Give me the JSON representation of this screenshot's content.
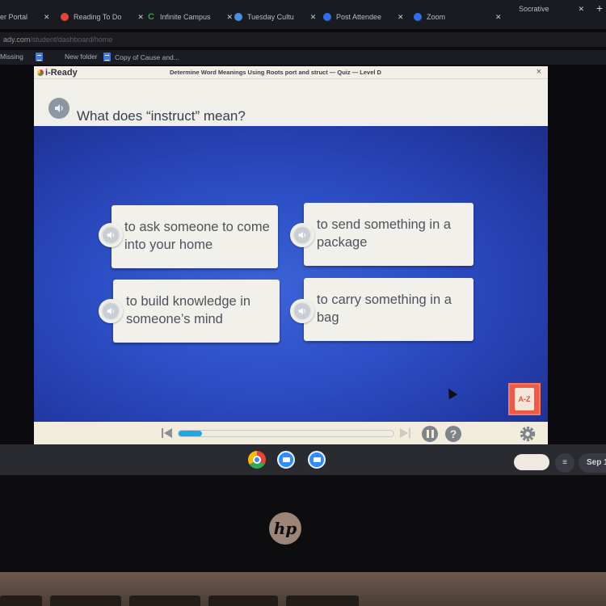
{
  "browser": {
    "tabs": [
      {
        "label": "er Portal",
        "icon": "portal-icon",
        "color": "#555b66"
      },
      {
        "label": "Reading To Do",
        "icon": "flower-icon",
        "color": "#e2463a"
      },
      {
        "label": "Infinite Campus",
        "icon": "campus-icon",
        "color": "#2e9e48"
      },
      {
        "label": "Tuesday Cultu",
        "icon": "globe-icon",
        "color": "#4a8fe0"
      },
      {
        "label": "Post Attendee",
        "icon": "zoom-icon",
        "color": "#2d6ff0"
      },
      {
        "label": "Zoom",
        "icon": "zoom-icon",
        "color": "#2d6ff0"
      },
      {
        "label": "Socrative",
        "icon": "socrative-icon",
        "color": "#666a72"
      }
    ],
    "new_tab_icon": "plus-icon",
    "address": {
      "host": "ady.com",
      "path": "/student/dashboard/home"
    },
    "bookmarks": [
      {
        "label": "Missing",
        "icon": "bookmark-icon"
      },
      {
        "label": "",
        "icon": "docs-icon"
      },
      {
        "label": "New folder",
        "icon": "folder-icon"
      },
      {
        "label": "Copy of Cause and...",
        "icon": "docs-icon"
      }
    ]
  },
  "app": {
    "brand": "i-Ready",
    "lesson_title": "Determine Word Meanings Using Roots port and struct — Quiz — Level D",
    "close_label": "×",
    "question": "What does “instruct” mean?",
    "choices": [
      {
        "text": "to ask someone to come into your home"
      },
      {
        "text": "to send something in a package"
      },
      {
        "text": "to build knowledge in someone’s mind"
      },
      {
        "text": "to carry something in a bag"
      }
    ],
    "glossary_label": "A-Z",
    "progress_percent": 11,
    "help_label": "?"
  },
  "shelf": {
    "apps": [
      "chrome",
      "zoom",
      "zoom"
    ],
    "date": "Sep 1"
  },
  "device": {
    "brand_logo": "hp"
  },
  "colors": {
    "stage_blue": "#2d4fc6",
    "progress_fill": "#1fa8e0",
    "glossary_red": "#ee5a45",
    "card_bg": "#f2f0ea"
  }
}
